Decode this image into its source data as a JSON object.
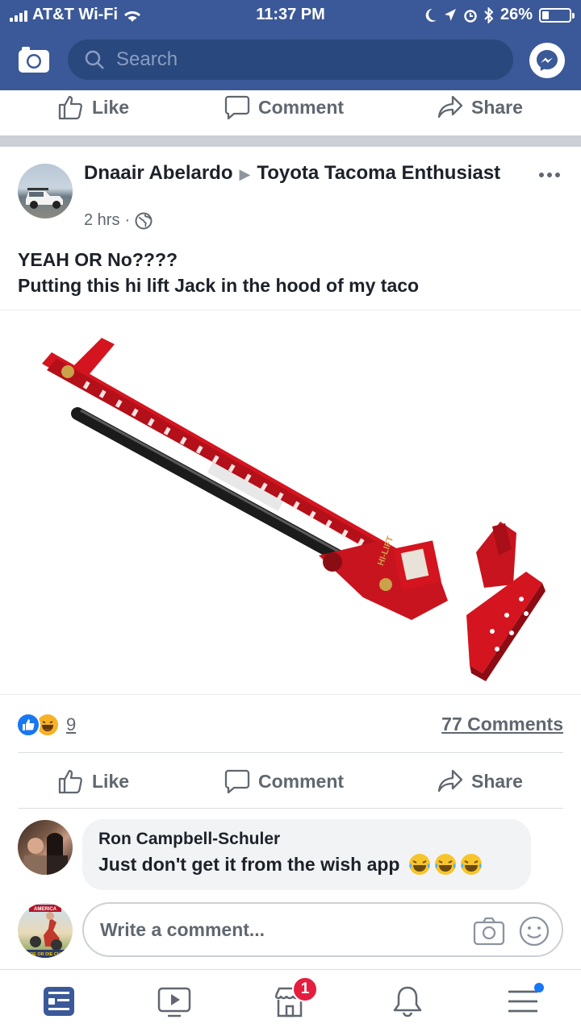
{
  "status_bar": {
    "carrier": "AT&T Wi-Fi",
    "time": "11:37 PM",
    "battery": "26%",
    "battery_level": 0.26
  },
  "header": {
    "search_placeholder": "Search",
    "camera_icon": "camera-icon",
    "messenger_icon": "messenger-icon",
    "brand_color": "#3b5998"
  },
  "top_actions": {
    "like": "Like",
    "comment": "Comment",
    "share": "Share"
  },
  "post": {
    "author": "Dnaair Abelardo",
    "group": "Toyota Tacoma Enthusiast",
    "time": "2 hrs",
    "audience_icon": "globe-icon",
    "text_line1": "YEAH OR No????",
    "text_line2": "Putting this hi lift Jack in the hood of my taco",
    "image_label": "HI-LIFT",
    "reaction_count": "9",
    "comments_count": "77 Comments",
    "reactions": [
      "like",
      "haha"
    ]
  },
  "post_actions": {
    "like": "Like",
    "comment": "Comment",
    "share": "Share"
  },
  "comment": {
    "name": "Ron Campbell-Schuler",
    "text": "Just don't get it from the wish app",
    "emoji": [
      "laughing-face",
      "laughing-face",
      "laughing-face"
    ]
  },
  "composer": {
    "placeholder": "Write a comment...",
    "avatar_badge_top": "AMERICA",
    "avatar_badge_bottom": "RIDE OR DIE CHIC"
  },
  "bottom_nav": {
    "items": [
      "news-feed",
      "watch",
      "marketplace",
      "notifications",
      "menu"
    ],
    "marketplace_badge": "1",
    "active_color": "#3b5998"
  }
}
